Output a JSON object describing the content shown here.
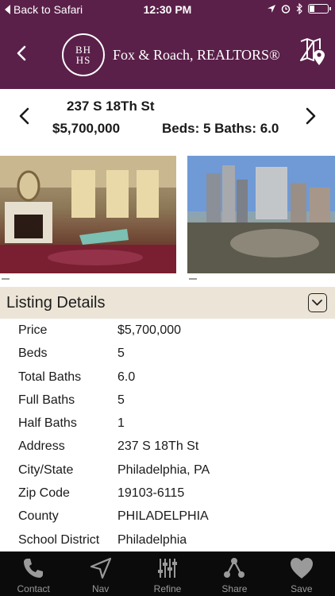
{
  "status_bar": {
    "back_label": "Back to Safari",
    "time": "12:30 PM"
  },
  "header": {
    "logo_text_top": "BH",
    "logo_text_bottom": "HS",
    "brand_name": "Fox & Roach, REALTORS®"
  },
  "property": {
    "address": "237 S 18Th St",
    "price": "$5,700,000",
    "beds_baths": "Beds: 5  Baths: 6.0"
  },
  "photos": [
    {
      "icon": "living-room-photo"
    },
    {
      "icon": "city-view-photo"
    }
  ],
  "section": {
    "title": "Listing Details"
  },
  "details": [
    {
      "label": "Price",
      "value": "$5,700,000"
    },
    {
      "label": "Beds",
      "value": "5"
    },
    {
      "label": "Total Baths",
      "value": "6.0"
    },
    {
      "label": "Full Baths",
      "value": "5"
    },
    {
      "label": "Half Baths",
      "value": "1"
    },
    {
      "label": "Address",
      "value": "237 S 18Th St"
    },
    {
      "label": "City/State",
      "value": "Philadelphia, PA"
    },
    {
      "label": "Zip Code",
      "value": "19103-6115"
    },
    {
      "label": "County",
      "value": "PHILADELPHIA"
    },
    {
      "label": "School District",
      "value": "Philadelphia"
    }
  ],
  "tabs": [
    {
      "label": "Contact",
      "icon": "phone-icon"
    },
    {
      "label": "Nav",
      "icon": "navigation-icon"
    },
    {
      "label": "Refine",
      "icon": "sliders-icon"
    },
    {
      "label": "Share",
      "icon": "share-icon"
    },
    {
      "label": "Save",
      "icon": "heart-icon"
    }
  ],
  "colors": {
    "brand": "#5a2049",
    "section_bg": "#ece5d7",
    "tabbar_bg": "#0b0b0b"
  }
}
